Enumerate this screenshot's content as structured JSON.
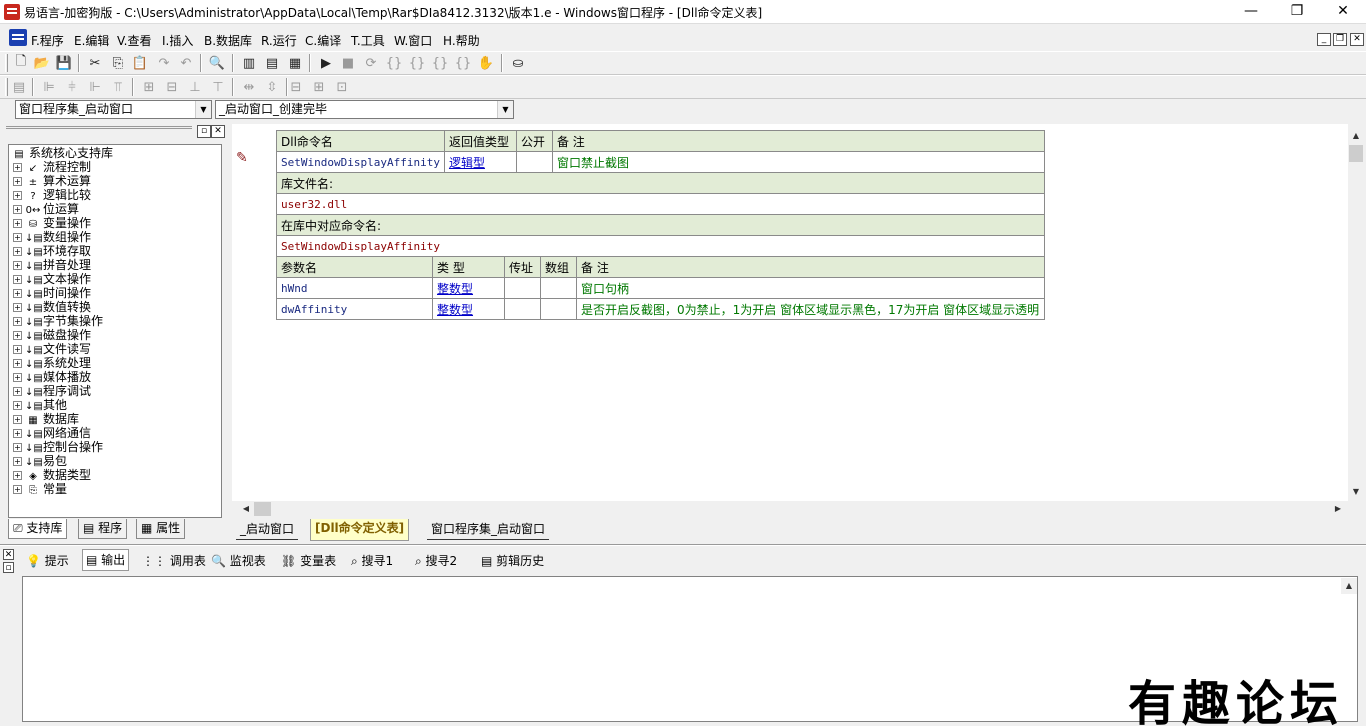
{
  "window": {
    "title": "易语言-加密狗版 - C:\\Users\\Administrator\\AppData\\Local\\Temp\\Rar$DIa8412.3132\\版本1.e - Windows窗口程序 - [Dll命令定义表]",
    "minimize_glyph": "—",
    "maximize_glyph": "❐",
    "close_glyph": "✕"
  },
  "menu": {
    "items": [
      {
        "label": "F.程序"
      },
      {
        "label": "E.编辑"
      },
      {
        "label": "V.查看"
      },
      {
        "label": "I.插入"
      },
      {
        "label": "B.数据库"
      },
      {
        "label": "R.运行"
      },
      {
        "label": "C.编译"
      },
      {
        "label": "T.工具"
      },
      {
        "label": "W.窗口"
      },
      {
        "label": "H.帮助"
      }
    ],
    "mdi_buttons": [
      "_",
      "❐",
      "✕"
    ]
  },
  "combos": {
    "left": "窗口程序集_启动窗口",
    "right": "_启动窗口_创建完毕"
  },
  "left_panel": {
    "tree": [
      {
        "label": "系统核心支持库",
        "icon": "library-icon",
        "root": true
      },
      {
        "label": "流程控制",
        "icon": "arrow-icon"
      },
      {
        "label": "算术运算",
        "icon": "math-icon"
      },
      {
        "label": "逻辑比较",
        "icon": "question-icon"
      },
      {
        "label": "位运算",
        "icon": "bit-icon"
      },
      {
        "label": "变量操作",
        "icon": "variable-icon"
      },
      {
        "label": "数组操作",
        "icon": "command-icon"
      },
      {
        "label": "环境存取",
        "icon": "command-icon"
      },
      {
        "label": "拼音处理",
        "icon": "command-icon"
      },
      {
        "label": "文本操作",
        "icon": "command-icon"
      },
      {
        "label": "时间操作",
        "icon": "command-icon"
      },
      {
        "label": "数值转换",
        "icon": "command-icon"
      },
      {
        "label": "字节集操作",
        "icon": "command-icon"
      },
      {
        "label": "磁盘操作",
        "icon": "command-icon"
      },
      {
        "label": "文件读写",
        "icon": "command-icon"
      },
      {
        "label": "系统处理",
        "icon": "command-icon"
      },
      {
        "label": "媒体播放",
        "icon": "command-icon"
      },
      {
        "label": "程序调试",
        "icon": "command-icon"
      },
      {
        "label": "其他",
        "icon": "command-icon"
      },
      {
        "label": "数据库",
        "icon": "grid-icon"
      },
      {
        "label": "网络通信",
        "icon": "command-icon"
      },
      {
        "label": "控制台操作",
        "icon": "command-icon"
      },
      {
        "label": "易包",
        "icon": "command-icon"
      },
      {
        "label": "数据类型",
        "icon": "datatype-icon"
      },
      {
        "label": "常量",
        "icon": "constant-icon"
      }
    ],
    "tabs": [
      {
        "label": "支持库"
      },
      {
        "label": "程序"
      },
      {
        "label": "属性"
      }
    ]
  },
  "dll_table": {
    "header": {
      "name": "Dll命令名",
      "return_type": "返回值类型",
      "public": "公开",
      "remark": "备 注"
    },
    "command": {
      "name": "SetWindowDisplayAffinity",
      "return_type": "逻辑型",
      "public": "",
      "remark": "窗口禁止截图"
    },
    "lib_file_label": "库文件名:",
    "lib_file": "user32.dll",
    "lib_cmd_label": "在库中对应命令名:",
    "lib_cmd": "SetWindowDisplayAffinity",
    "param_header": {
      "name": "参数名",
      "type": "类 型",
      "byref": "传址",
      "array": "数组",
      "remark": "备 注"
    },
    "params": [
      {
        "name": "hWnd",
        "type": "整数型",
        "remark": "窗口句柄"
      },
      {
        "name": "dwAffinity",
        "type": "整数型",
        "remark": "是否开启反截图，0为禁止，1为开启 窗体区域显示黑色，17为开启 窗体区域显示透明"
      }
    ]
  },
  "editor_tabs": [
    {
      "label": "_启动窗口",
      "active": false
    },
    {
      "label": "[Dll命令定义表]",
      "active": true
    },
    {
      "label": "窗口程序集_启动窗口",
      "active": false
    }
  ],
  "bottom_tabs": [
    {
      "label": "提示"
    },
    {
      "label": "输出"
    },
    {
      "label": "调用表"
    },
    {
      "label": "监视表"
    },
    {
      "label": "变量表"
    },
    {
      "label": "搜寻1"
    },
    {
      "label": "搜寻2"
    },
    {
      "label": "剪辑历史"
    }
  ],
  "watermark": "有趣论坛"
}
